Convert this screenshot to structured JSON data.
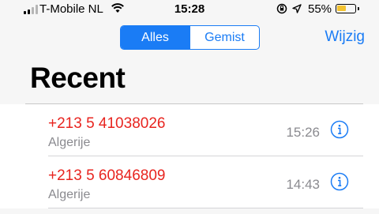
{
  "status_bar": {
    "carrier": "T-Mobile NL",
    "time": "15:28",
    "battery_percent": "55%",
    "signal_bars_filled": 2,
    "signal_bars_total": 4,
    "battery_level": 0.55
  },
  "segmented_control": {
    "items": [
      {
        "label": "Alles",
        "selected": true
      },
      {
        "label": "Gemist",
        "selected": false
      }
    ]
  },
  "edit_label": "Wijzig",
  "page_title": "Recent",
  "calls": [
    {
      "number": "+213 5 41038026",
      "location": "Algerije",
      "time": "15:26",
      "missed": true
    },
    {
      "number": "+213 5 60846809",
      "location": "Algerije",
      "time": "14:43",
      "missed": true
    }
  ],
  "colors": {
    "accent": "#1a7cf5",
    "missed": "#e8241f",
    "secondary_text": "#8a8a8f",
    "battery": "#f2c230"
  }
}
